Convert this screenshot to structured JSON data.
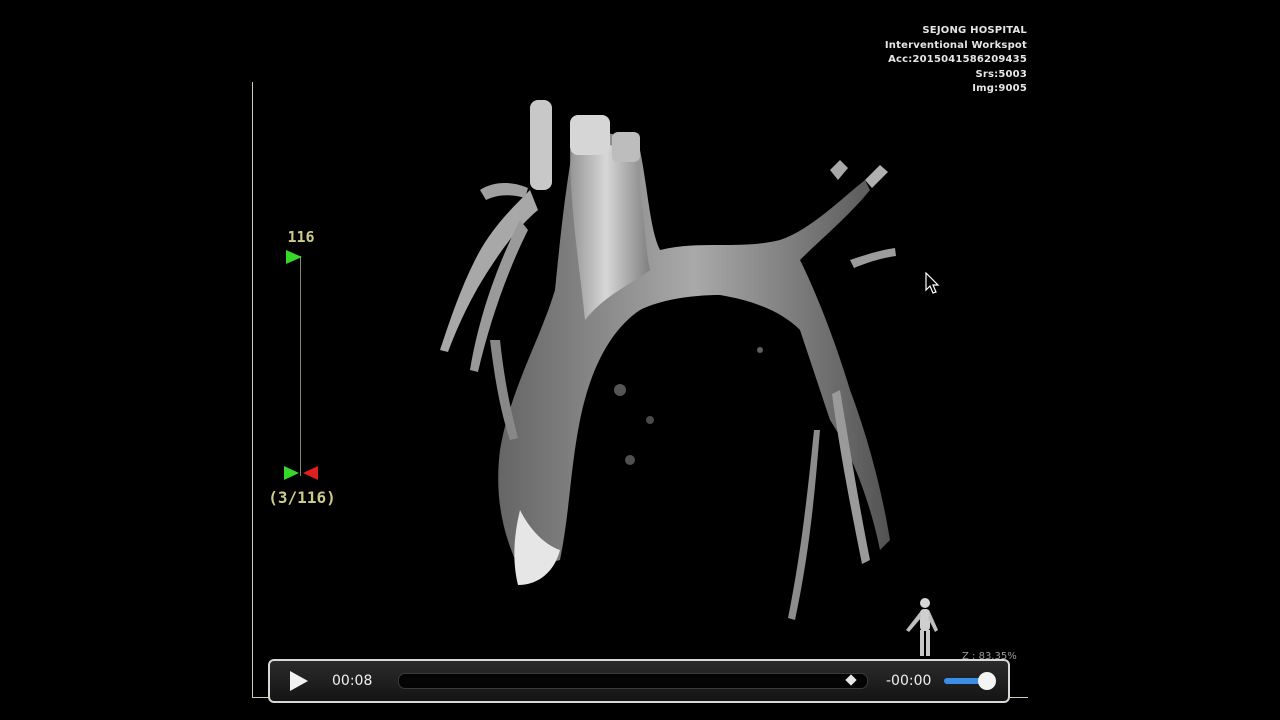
{
  "overlay": {
    "hospital": "SEJONG HOSPITAL",
    "workspot": "Interventional Workspot",
    "accession": "Acc:2015041586209435",
    "series": "Srs:5003",
    "image": "Img:9005",
    "zoom": "Z : 83.35%"
  },
  "frame_slider": {
    "max_label": "116",
    "counter": "(3/116)",
    "top_flag_color": "#36d92a",
    "bottom_flag_left_color": "#36d92a",
    "bottom_flag_right_color": "#e02020"
  },
  "player": {
    "elapsed": "00:08",
    "remaining": "-00:00",
    "progress": 0.97,
    "volume": 0.9,
    "accent": "#3a8ee6"
  },
  "icons": {
    "play": "play-icon",
    "cursor": "mouse-pointer-icon",
    "orientation": "human-figure-icon"
  }
}
